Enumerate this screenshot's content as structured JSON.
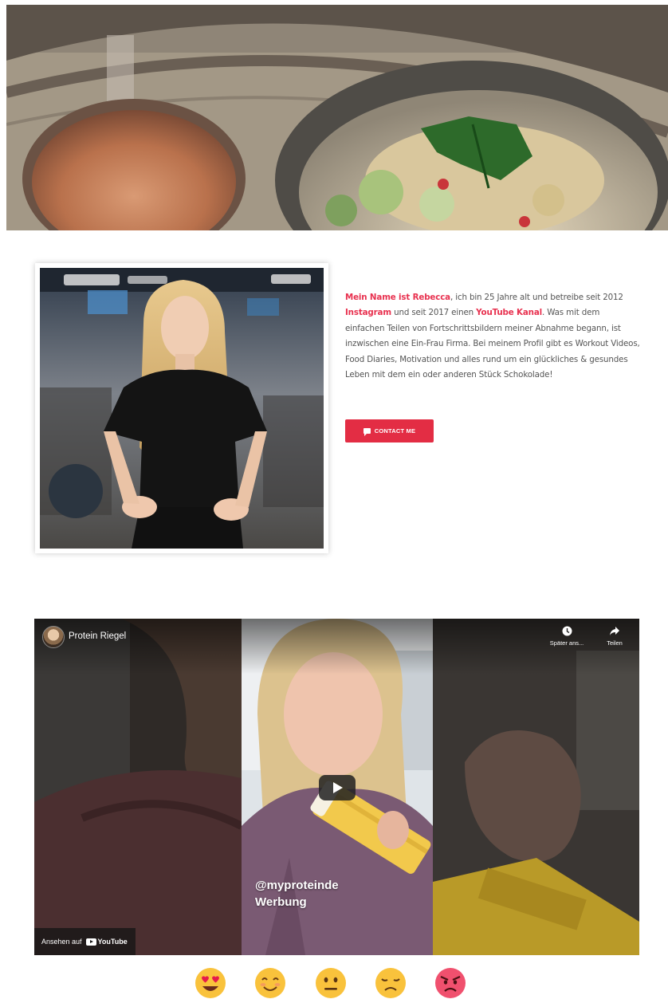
{
  "bio": {
    "name_phrase": "Mein Name ist Rebecca",
    "text_1": ", ich bin 25 Jahre alt und betreibe seit 2012 ",
    "instagram": "Instagram",
    "text_2": " und seit 2017 einen ",
    "youtube": "YouTube Kanal",
    "text_3": ". Was mit dem einfachen Teilen von Fortschrittsbildern meiner Abnahme begann, ist inzwischen eine Ein-Frau Firma. Bei meinem Profil gibt es Workout Videos, Food Diaries, Motivation und alles rund um ein glückliches & gesundes Leben mit dem ein oder anderen Stück Schokolade!"
  },
  "contact_button": {
    "label": "CONTACT ME",
    "icon": "chat-icon"
  },
  "video": {
    "title": "Protein Riegel",
    "watch_later": "Später ans...",
    "share": "Teilen",
    "caption_line1": "@myproteinde",
    "caption_line2": "Werbung",
    "watch_on": "Ansehen auf",
    "youtube_brand": "YouTube"
  },
  "reactions": [
    "heart-eyes",
    "smiling",
    "neutral",
    "disappointed",
    "angry"
  ],
  "colors": {
    "accent": "#e32d44",
    "highlight": "#e8314f",
    "text": "#555555"
  }
}
